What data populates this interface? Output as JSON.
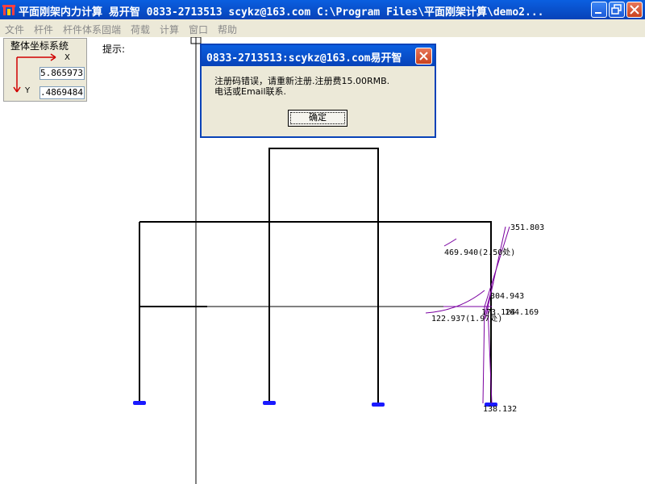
{
  "window": {
    "title": "平面刚架内力计算 易开智 0833-2713513 scykz@163.com C:\\Program Files\\平面刚架计算\\demo2..."
  },
  "menu": [
    "文件",
    "杆件",
    "杆件体系固端",
    "荷载",
    "计算",
    "窗口",
    "帮助"
  ],
  "coords": {
    "title": "整体坐标系统",
    "x_label": "X",
    "y_label": "Y",
    "x_value": "5.865973",
    "y_value": ".4869484"
  },
  "hint": "提示:",
  "dialog": {
    "title": "0833-2713513:scykz@163.com易开智",
    "message": "注册码错误，请重新注册.注册费15.00RMB.\n电话或Email联系.",
    "ok_label": "确定"
  },
  "labels": {
    "top": "351.803",
    "mid": "469.940(2.50处)",
    "v1": "304.943",
    "v2": "173.124",
    "v3": "164.169",
    "low": "122.937(1.97处)",
    "base": "138.132"
  },
  "colors": {
    "title_bar": "#0842b8",
    "dialog_border": "#0842b8",
    "support": "#1a1aff",
    "diagram": "#7a00a0",
    "arrow": "#d00000"
  }
}
